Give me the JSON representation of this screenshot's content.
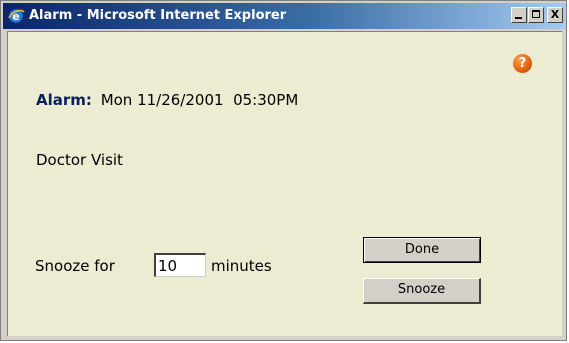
{
  "window": {
    "title": "Alarm - Microsoft Internet Explorer",
    "title_icon": "ie-icon",
    "controls": {
      "minimize_icon": "minimize-icon",
      "maximize_icon": "maximize-icon",
      "close_glyph": "X"
    }
  },
  "content": {
    "background_color": "#ececd2",
    "help_glyph": "?",
    "alarm": {
      "label": "Alarm:",
      "datetime": "Mon 11/26/2001  05:30PM"
    },
    "event_text": "Doctor Visit",
    "snooze": {
      "label": "Snooze for",
      "value": "10",
      "units": "minutes"
    },
    "buttons": {
      "done": "Done",
      "snooze": "Snooze"
    }
  }
}
